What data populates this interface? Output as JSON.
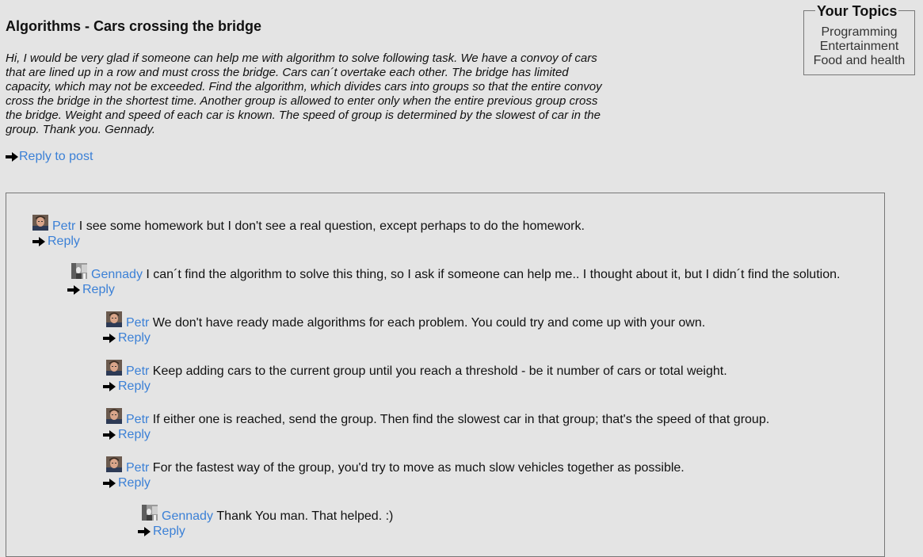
{
  "post": {
    "title": "Algorithms - Cars crossing the bridge",
    "body_lines": [
      "Hi, I would be very glad if someone can help me with algorithm to solve following task. We have a convoy of cars",
      "that are lined up in a row and must cross the bridge. Cars can´t overtake each other. The bridge has limited",
      "capacity, which may not be exceeded. Find the algorithm, which divides cars into groups so that the entire convoy",
      "cross the bridge in the shortest time. Another group is allowed to enter only when the entire previous group cross",
      "the bridge. Weight and speed of each car is known. The speed of group is determined by the slowest of car in the",
      "group. Thank you. Gennady."
    ],
    "reply_label": "Reply to post"
  },
  "topics": {
    "legend": "Your Topics",
    "items": [
      "Programming",
      "Entertainment",
      "Food and health"
    ]
  },
  "comments": [
    {
      "author": "Petr",
      "text": "I see some homework but I don't see a real question, except perhaps to do the homework.",
      "reply": "Reply",
      "avatar": "petr-avatar"
    },
    {
      "author": "Gennady",
      "text": "I can´t find the algorithm to solve this thing, so I ask if someone can help me.. I thought about it, but I didn´t find the solution.",
      "reply": "Reply",
      "avatar": "gennady-avatar"
    },
    {
      "author": "Petr",
      "text": "We don't have ready made algorithms for each problem. You could try and come up with your own.",
      "reply": "Reply",
      "avatar": "petr-avatar"
    },
    {
      "author": "Petr",
      "text": "Keep adding cars to the current group until you reach a threshold - be it number of cars or total weight.",
      "reply": "Reply",
      "avatar": "petr-avatar"
    },
    {
      "author": "Petr",
      "text": "If either one is reached, send the group. Then find the slowest car in that group; that's the speed of that group.",
      "reply": "Reply",
      "avatar": "petr-avatar"
    },
    {
      "author": "Petr",
      "text": "For the fastest way of the group, you'd try to move as much slow vehicles together as possible.",
      "reply": "Reply",
      "avatar": "petr-avatar"
    },
    {
      "author": "Gennady",
      "text": "Thank You man. That helped. :)",
      "reply": "Reply",
      "avatar": "gennady-avatar"
    }
  ],
  "colors": {
    "link": "#3b80d6",
    "background": "#e4e4e4"
  }
}
